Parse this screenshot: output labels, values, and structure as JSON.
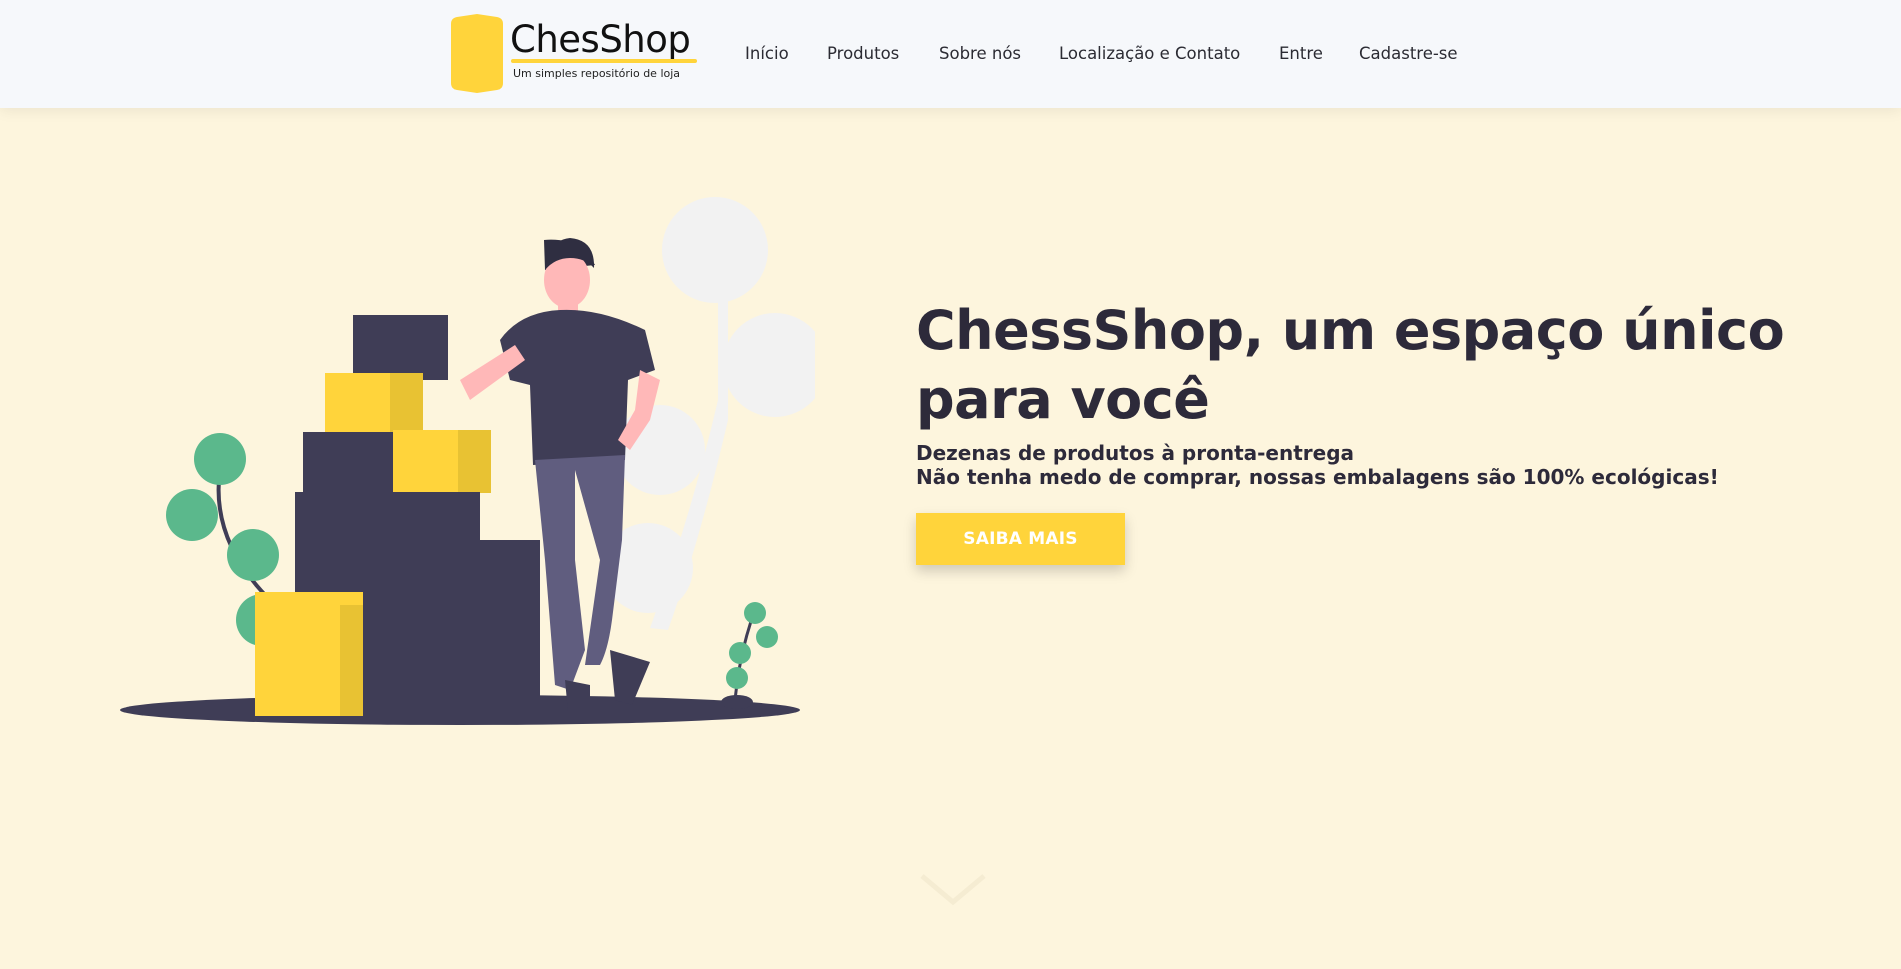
{
  "header": {
    "logo": {
      "title": "ChesShop",
      "subtitle": "Um simples repositório de loja"
    },
    "nav": [
      {
        "label": "Início"
      },
      {
        "label": "Produtos"
      },
      {
        "label": "Sobre nós"
      },
      {
        "label": "Localização e Contato"
      },
      {
        "label": "Entre"
      },
      {
        "label": "Cadastre-se"
      }
    ]
  },
  "hero": {
    "title": "ChessShop, um espaço único para você",
    "subtitle_line1": "Dezenas de produtos à pronta-entrega",
    "subtitle_line2": "Não tenha medo de comprar, nossas embalagens são 100% ecológicas!",
    "cta_label": "SAIBA MAIS"
  },
  "colors": {
    "background": "#fdf5dd",
    "header_bg": "#f6f8fb",
    "accent": "#ffd43b",
    "text_dark": "#2d2a3a",
    "box_dark": "#3f3d56",
    "plant_green": "#5bb88c"
  },
  "icons": {
    "scroll": "chevron-down-icon"
  }
}
